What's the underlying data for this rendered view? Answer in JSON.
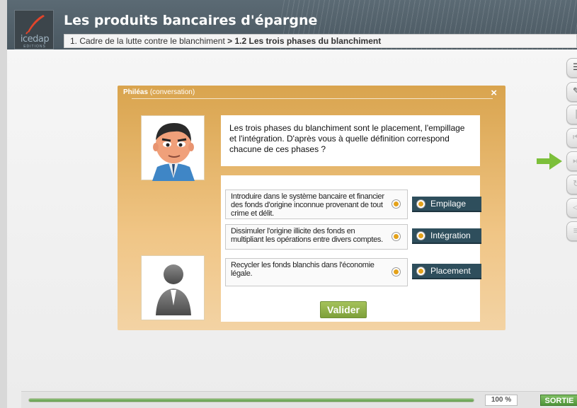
{
  "app": {
    "title": "Les produits bancaires d'épargne",
    "logo_brand": "icedap",
    "logo_sub": "EDITIONS"
  },
  "breadcrumb": {
    "section": "1. Cadre de la lutte contre le blanchiment",
    "separator": " > ",
    "current": "1.2 Les trois phases du blanchiment"
  },
  "dialog": {
    "speaker_name": "Philéas",
    "mode": "(conversation)",
    "close_label": "×",
    "question": "Les trois phases du blanchiment sont le placement, l'empillage et l'intégration. D'après vous à quelle définition correspond chacune de ces phases ?",
    "definitions": [
      "Introduire dans le système bancaire et financier des fonds d'origine inconnue provenant de tout crime et délit.",
      "Dissimuler l'origine illicite des fonds en multipliant les opérations entre divers comptes.",
      "Recycler les fonds blanchis dans l'économie légale."
    ],
    "phases": [
      "Empilage",
      "Intégration",
      "Placement"
    ],
    "validate_label": "Valider"
  },
  "toolbar": {
    "icons": [
      "list-icon",
      "wrench-icon",
      "pause-icon",
      "skip-back-icon",
      "skip-forward-icon",
      "replay-icon",
      "audio-icon",
      "chat-icon"
    ],
    "active": [
      "list-icon",
      "wrench-icon"
    ],
    "glyphs": [
      "☰",
      "✎",
      "❙❙",
      "⏮",
      "⏭",
      "↻",
      "◁",
      "≡"
    ]
  },
  "footer": {
    "progress_percent": 100,
    "progress_label": "100 %",
    "exit_label": "SORTIE"
  },
  "colors": {
    "header": "#4f5d66",
    "dialog": "#e8b56a",
    "chip": "#2e4e5c",
    "accent_green": "#7da03a"
  }
}
